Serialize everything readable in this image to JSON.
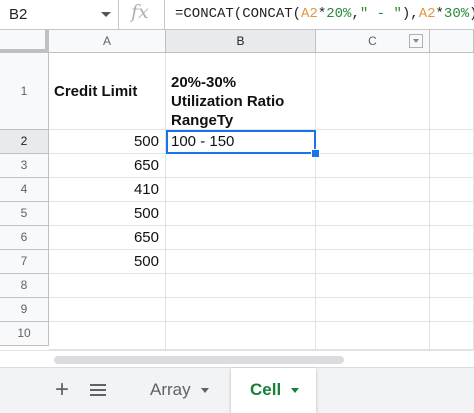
{
  "formula_bar": {
    "cell_ref": "B2",
    "fx": "fx",
    "formula_prefix": "=CONCAT(CONCAT(",
    "formula_ref1": "A2",
    "formula_mid1": "*",
    "formula_num1": "20%",
    "formula_mid2": ",",
    "formula_str": "\" - \"",
    "formula_mid3": "),",
    "formula_ref2": "A2",
    "formula_mid4": "*",
    "formula_num2": "30%",
    "formula_suffix": ")"
  },
  "columns": [
    "A",
    "B",
    "C"
  ],
  "rows": [
    "1",
    "2",
    "3",
    "4",
    "5",
    "6",
    "7",
    "8",
    "9",
    "10"
  ],
  "cells": {
    "a1": "Credit Limit",
    "b1": "20%-30% Utilization Ratio RangeTy",
    "b2": "100 - 150",
    "a_values": [
      "500",
      "650",
      "410",
      "500",
      "650",
      "500"
    ]
  },
  "tabs": {
    "add": "+",
    "array": "Array",
    "cell": "Cell"
  },
  "colors": {
    "selection": "#1a73e8",
    "active_tab": "#188038"
  }
}
